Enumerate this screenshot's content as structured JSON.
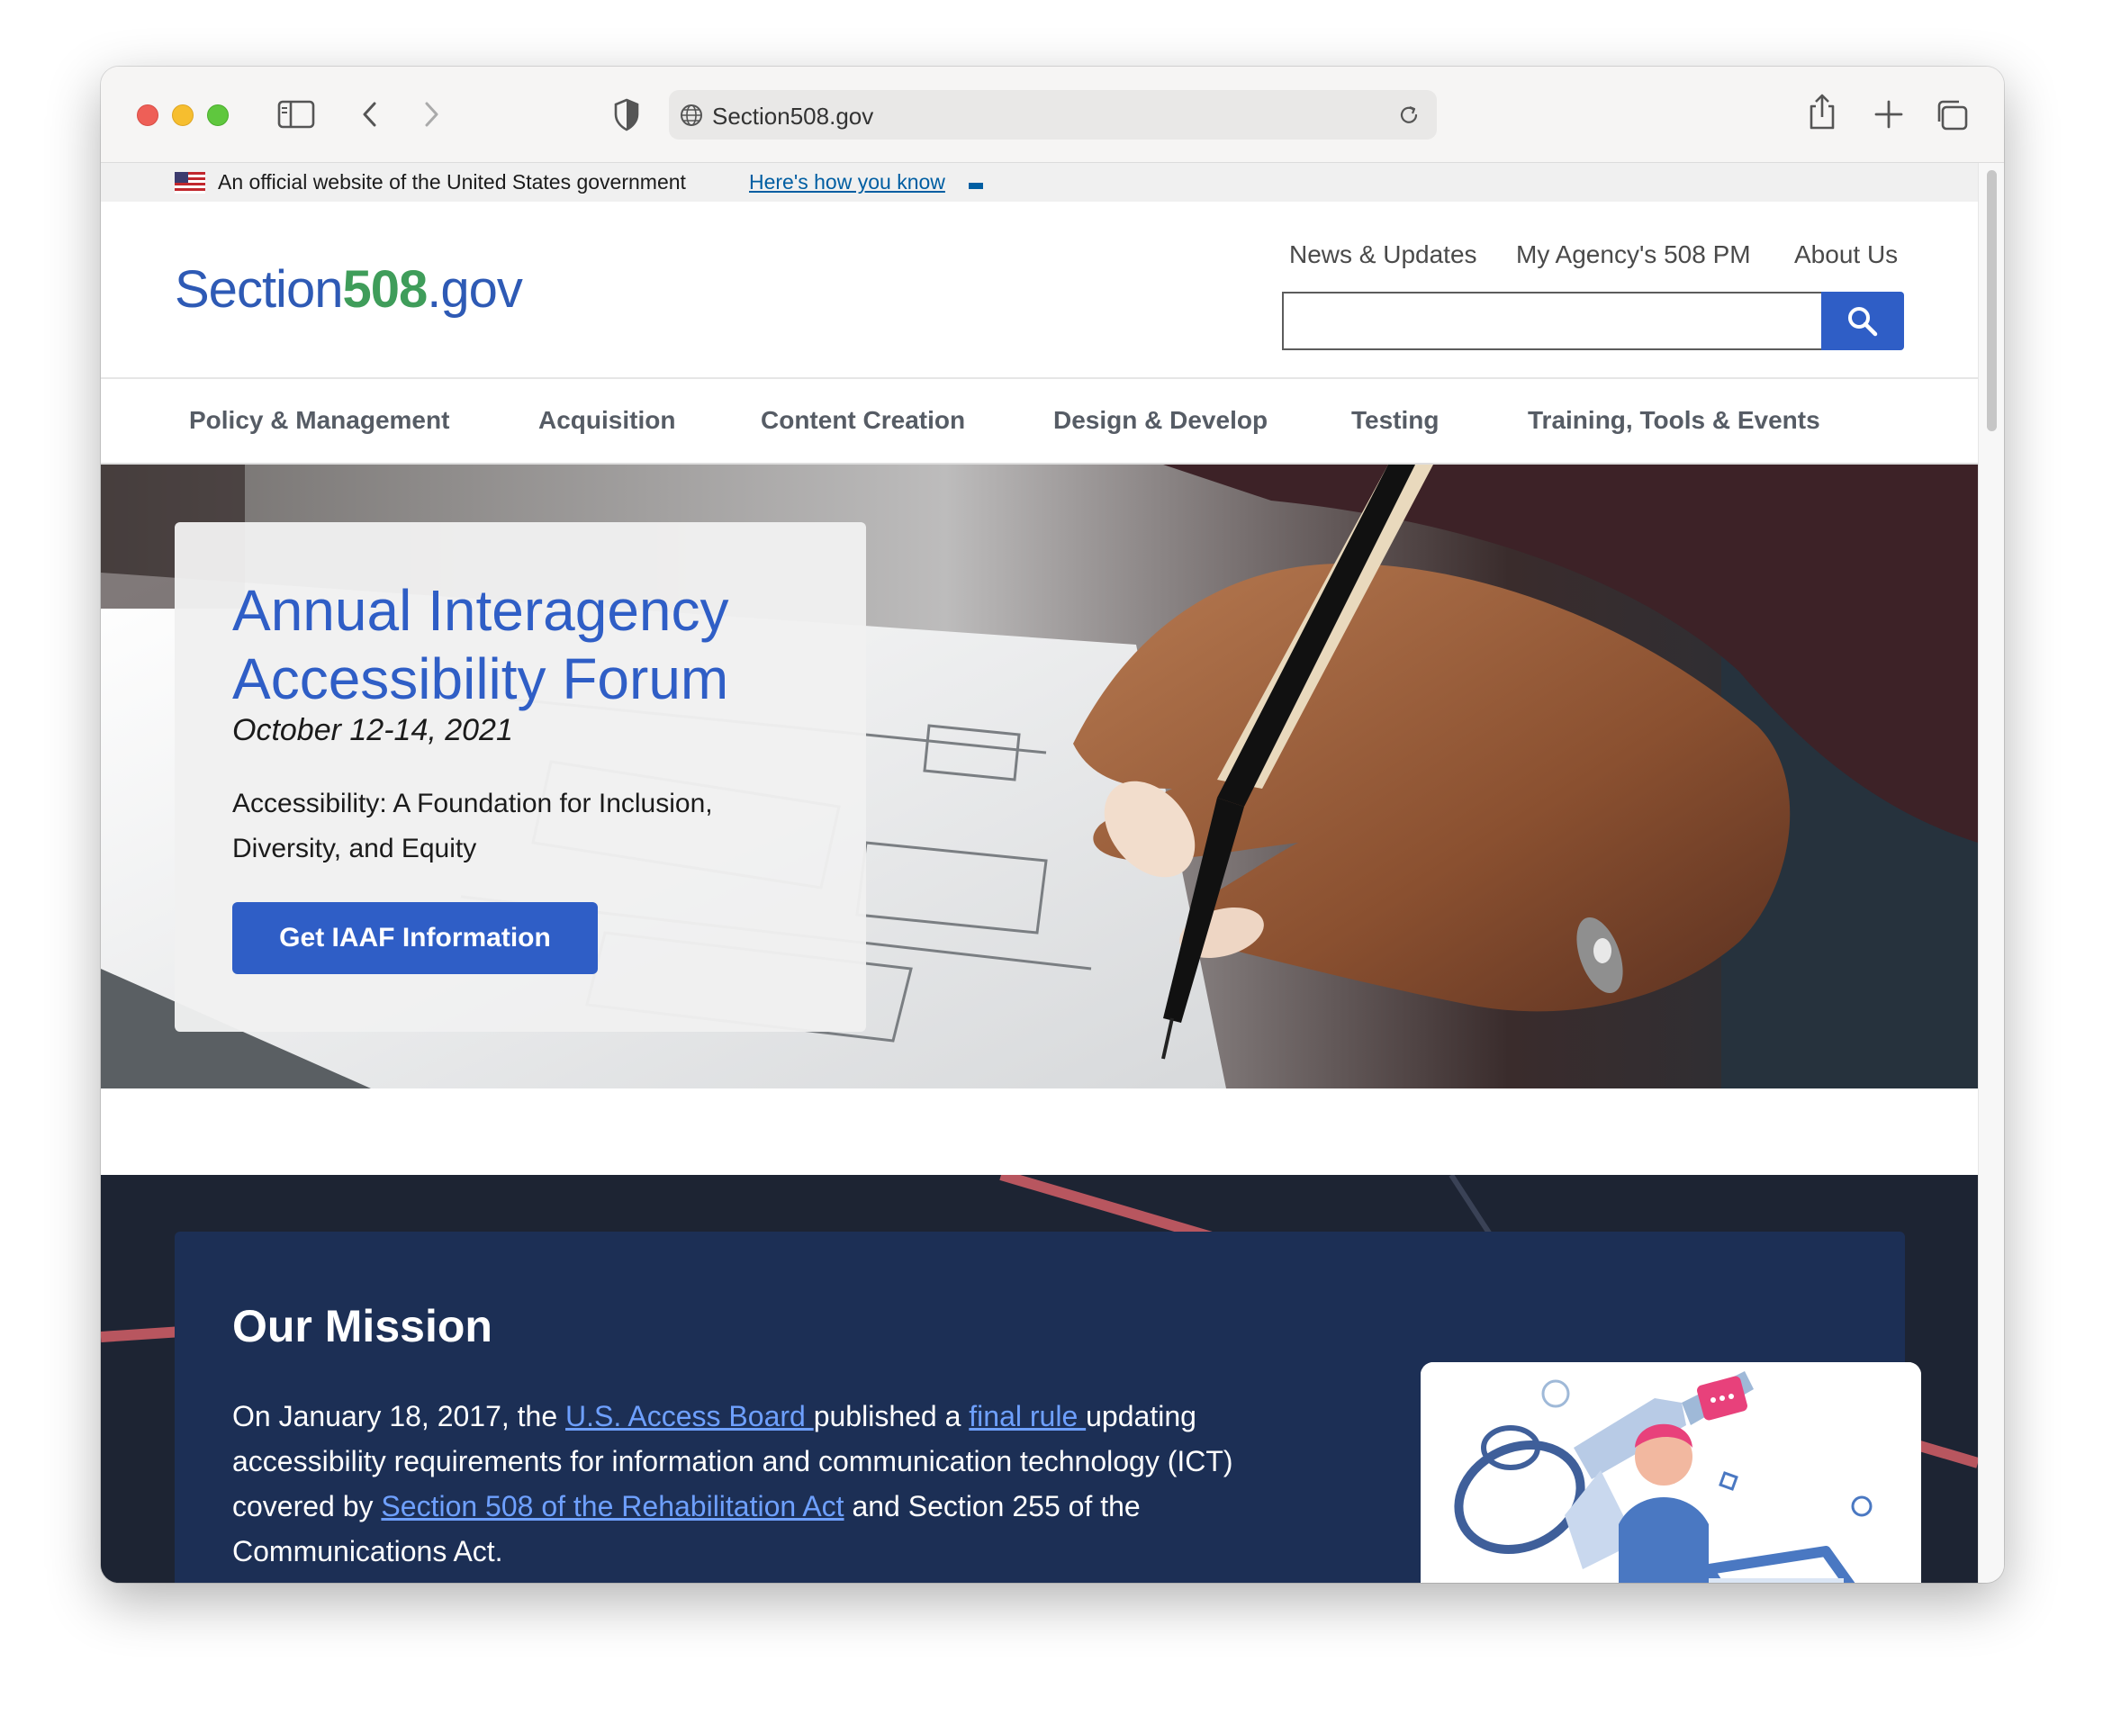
{
  "browser": {
    "url": "Section508.gov"
  },
  "gov_banner": {
    "text": "An official website of the United States government",
    "link": "Here's how you know"
  },
  "header": {
    "logo_part1": "Section",
    "logo_part2": "508",
    "logo_part3": ".gov",
    "utility_links": [
      "News & Updates",
      "My Agency's 508 PM",
      "About Us"
    ],
    "search_value": ""
  },
  "nav": {
    "items": [
      "Policy & Management",
      "Acquisition",
      "Content Creation",
      "Design & Develop",
      "Testing",
      "Training, Tools & Events"
    ]
  },
  "hero": {
    "title": "Annual Interagency Accessibility Forum",
    "date": "October 12-14, 2021",
    "description": "Accessibility: A Foundation for Inclusion, Diversity, and Equity",
    "button": "Get IAAF Information"
  },
  "mission": {
    "title": "Our Mission",
    "text1": "On January 18, 2017, the ",
    "link1": "U.S. Access Board ",
    "text2": "published a ",
    "link2": "final rule ",
    "text3": "updating accessibility requirements for information and communication technology (ICT) covered by ",
    "link3": "Section 508 of the Rehabilitation Act",
    "text4": " and Section 255 of the Communications Act."
  },
  "colors": {
    "primary_blue": "#2f5ec6",
    "logo_green": "#3f9d5a",
    "mission_navy": "#1c2f55"
  }
}
